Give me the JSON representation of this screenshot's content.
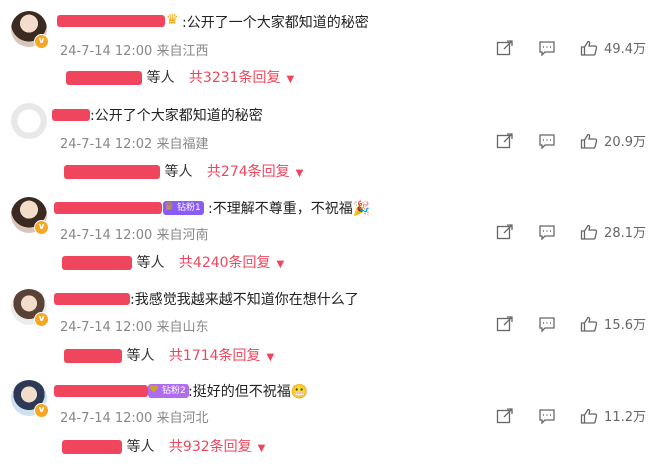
{
  "comments": [
    {
      "text": ":公开了一个大家都知道的秘密",
      "date": "24-7-14 12:00",
      "location": "来自江西",
      "likes": "49.4万",
      "reply_suffix": "等人",
      "reply_count": "共3231条回复"
    },
    {
      "text": ":公开了个大家都知道的秘密",
      "date": "24-7-14 12:02",
      "location": "来自福建",
      "likes": "20.9万",
      "reply_suffix": "等人",
      "reply_count": "共274条回复"
    },
    {
      "text": ":不理解不尊重，不祝福",
      "badge": "钻粉1",
      "date": "24-7-14 12:00",
      "location": "来自河南",
      "likes": "28.1万",
      "reply_suffix": "等人",
      "reply_count": "共4240条回复"
    },
    {
      "text": ":我感觉我越来越不知道你在想什么了",
      "date": "24-7-14 12:00",
      "location": "来自山东",
      "likes": "15.6万",
      "reply_suffix": "等人",
      "reply_count": "共1714条回复"
    },
    {
      "text": ":挺好的但不祝福",
      "badge": "钻粉2",
      "date": "24-7-14 12:00",
      "location": "来自河北",
      "likes": "11.2万",
      "reply_suffix": "等人",
      "reply_count": "共932条回复"
    }
  ],
  "icons": {
    "share": "share-icon",
    "comment": "comment-icon",
    "like": "like-icon",
    "caret": "caret-down-icon"
  },
  "colors": {
    "redact": "#f0465d",
    "accent": "#f0465d",
    "meta": "#888888"
  }
}
